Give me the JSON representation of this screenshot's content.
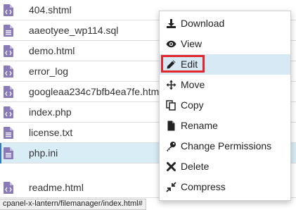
{
  "files": [
    {
      "name": "404.shtml",
      "icon": "code-file-icon"
    },
    {
      "name": "aaeotyee_wp114.sql",
      "icon": "text-file-icon"
    },
    {
      "name": "demo.html",
      "icon": "code-file-icon"
    },
    {
      "name": "error_log",
      "icon": "code-file-icon"
    },
    {
      "name": "googleaa234c7bfb4ea7fe.htm",
      "icon": "code-file-icon"
    },
    {
      "name": "index.php",
      "icon": "code-file-icon"
    },
    {
      "name": "license.txt",
      "icon": "text-file-icon"
    },
    {
      "name": "php.ini",
      "icon": "text-file-icon",
      "selected": true
    },
    {
      "name": "readme.html",
      "icon": "code-file-icon"
    }
  ],
  "status_bar": {
    "url": "cpanel-x-lantern/filemanager/index.html#"
  },
  "context_menu": {
    "items": [
      {
        "label": "Download",
        "icon": "download-icon"
      },
      {
        "label": "View",
        "icon": "eye-icon"
      },
      {
        "label": "Edit",
        "icon": "pencil-icon",
        "hovered": true,
        "highlighted": true
      },
      {
        "label": "Move",
        "icon": "move-arrows-icon"
      },
      {
        "label": "Copy",
        "icon": "copy-icon"
      },
      {
        "label": "Rename",
        "icon": "file-icon"
      },
      {
        "label": "Change Permissions",
        "icon": "key-icon"
      },
      {
        "label": "Delete",
        "icon": "x-icon"
      },
      {
        "label": "Compress",
        "icon": "compress-icon"
      }
    ]
  },
  "colors": {
    "file_icon": "#8a7bb8",
    "selected_row": "#d9edf7",
    "menu_hover": "#d6e9f5",
    "highlight_border": "#e3262c"
  }
}
